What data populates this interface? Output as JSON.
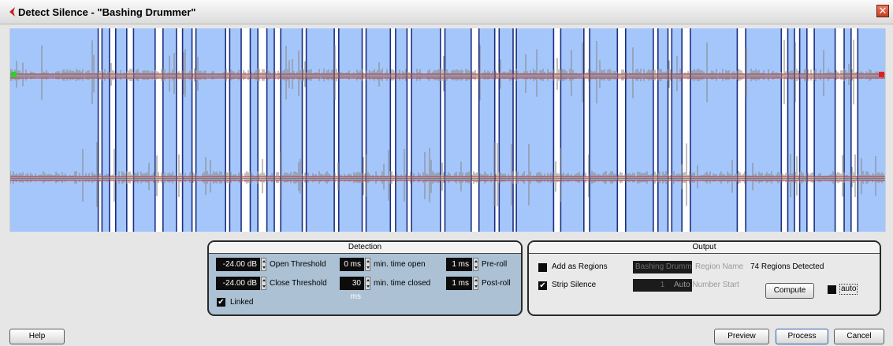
{
  "window": {
    "title": "Detect Silence - \"Bashing Drummer\"",
    "close_glyph": "✕"
  },
  "colors": {
    "waveform_bg": "#a4c6fb",
    "silence": "#ffffff",
    "marker": "#1a2f80",
    "threshold": "#d0312d",
    "wave": "#8a8a8a"
  },
  "detection": {
    "title": "Detection",
    "open_threshold": {
      "value": "-24.00 dB",
      "label": "Open Threshold"
    },
    "close_threshold": {
      "value": "-24.00 dB",
      "label": "Close Threshold"
    },
    "min_time_open": {
      "value": "0 ms",
      "label": "min. time open"
    },
    "min_time_closed": {
      "value": "30 ms",
      "label": "min. time closed"
    },
    "pre_roll": {
      "value": "1 ms",
      "label": "Pre-roll"
    },
    "post_roll": {
      "value": "1 ms",
      "label": "Post-roll"
    },
    "linked": {
      "label": "Linked",
      "checked": true
    }
  },
  "output": {
    "title": "Output",
    "add_as_regions": {
      "label": "Add as Regions",
      "checked": false
    },
    "strip_silence": {
      "label": "Strip Silence",
      "checked": true
    },
    "region_name": {
      "value": "Bashing Drummer",
      "label": "Region Name"
    },
    "auto_number_start": {
      "value": "1",
      "label": "Auto Number Start"
    },
    "regions_detected": "74 Regions Detected",
    "compute_button": "Compute",
    "auto": {
      "label": "auto",
      "checked": false
    }
  },
  "buttons": {
    "help": "Help",
    "preview": "Preview",
    "process": "Process",
    "cancel": "Cancel"
  }
}
